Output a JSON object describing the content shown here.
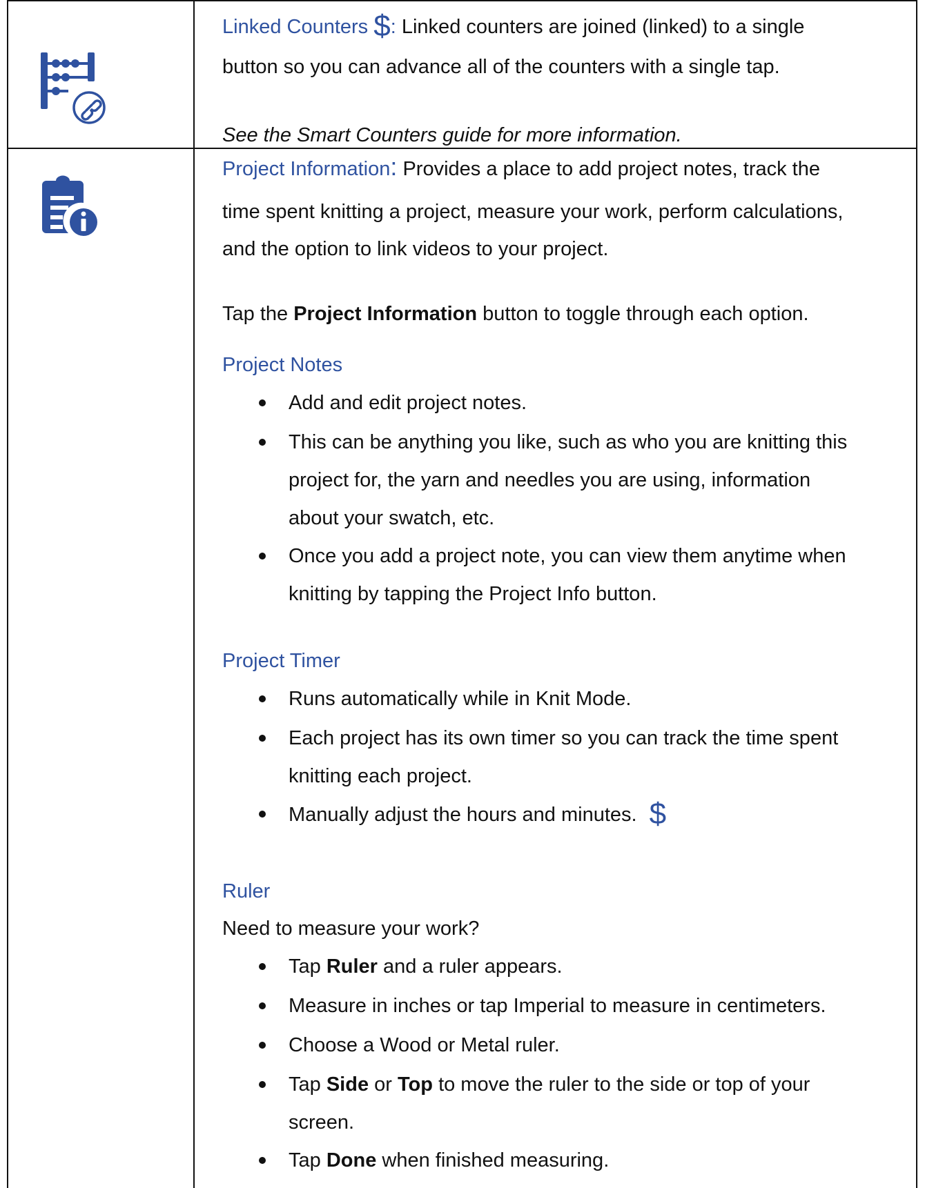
{
  "linked_counters": {
    "heading": "Linked Counters",
    "price_symbol": "$",
    "colon": ":",
    "line1": "Linked counters are joined (linked) to a single",
    "line2": "button so you can advance all of the counters with a single tap.",
    "note": "See the Smart Counters guide for more information.",
    "icon": "linked-counters-abacus-icon"
  },
  "project_information": {
    "heading": "Project Information",
    "colon": ":",
    "line1": "Provides a place to add project notes, track the",
    "line2": "time spent knitting a project, measure your work, perform calculations,",
    "line3": "and the option to link videos to your project.",
    "tap_pre": "Tap the",
    "tap_bold": "Project Information",
    "tap_post": "button to toggle through each option.",
    "icon": "project-info-document-icon"
  },
  "project_notes": {
    "heading": "Project Notes",
    "b1": "Add and edit project notes.",
    "b2_l1": "This can be anything you like, such as who you are knitting this",
    "b2_l2": "project for, the yarn and needles you are using, information",
    "b2_l3": "about your swatch, etc.",
    "b3_l1": "Once you add a project note, you can view them anytime when",
    "b3_l2": "knitting by tapping the Project Info button."
  },
  "project_timer": {
    "heading": "Project Timer",
    "b1": "Runs automatically while in Knit Mode.",
    "b2_l1": "Each project has its own timer so you can track the time spent",
    "b2_l2": "knitting each project.",
    "b3": "Manually adjust the hours and minutes.",
    "price_symbol": "$"
  },
  "ruler": {
    "heading": "Ruler",
    "intro": "Need to measure your work?",
    "b1_pre": "Tap",
    "b1_bold": "Ruler",
    "b1_post": "and a ruler appears.",
    "b2": "Measure in inches or tap Imperial to measure in centimeters.",
    "b3": "Choose a Wood or Metal ruler.",
    "b4_pre": "Tap",
    "b4_bold1": "Side",
    "b4_mid": "or",
    "b4_bold2": "Top",
    "b4_post": "to move the ruler to the side or top of your",
    "b4_l2": "screen.",
    "b5_pre": "Tap",
    "b5_bold": "Done",
    "b5_post": "when finished measuring."
  },
  "colors": {
    "accent": "#2f52a0",
    "text": "#111111",
    "border": "#111111"
  }
}
